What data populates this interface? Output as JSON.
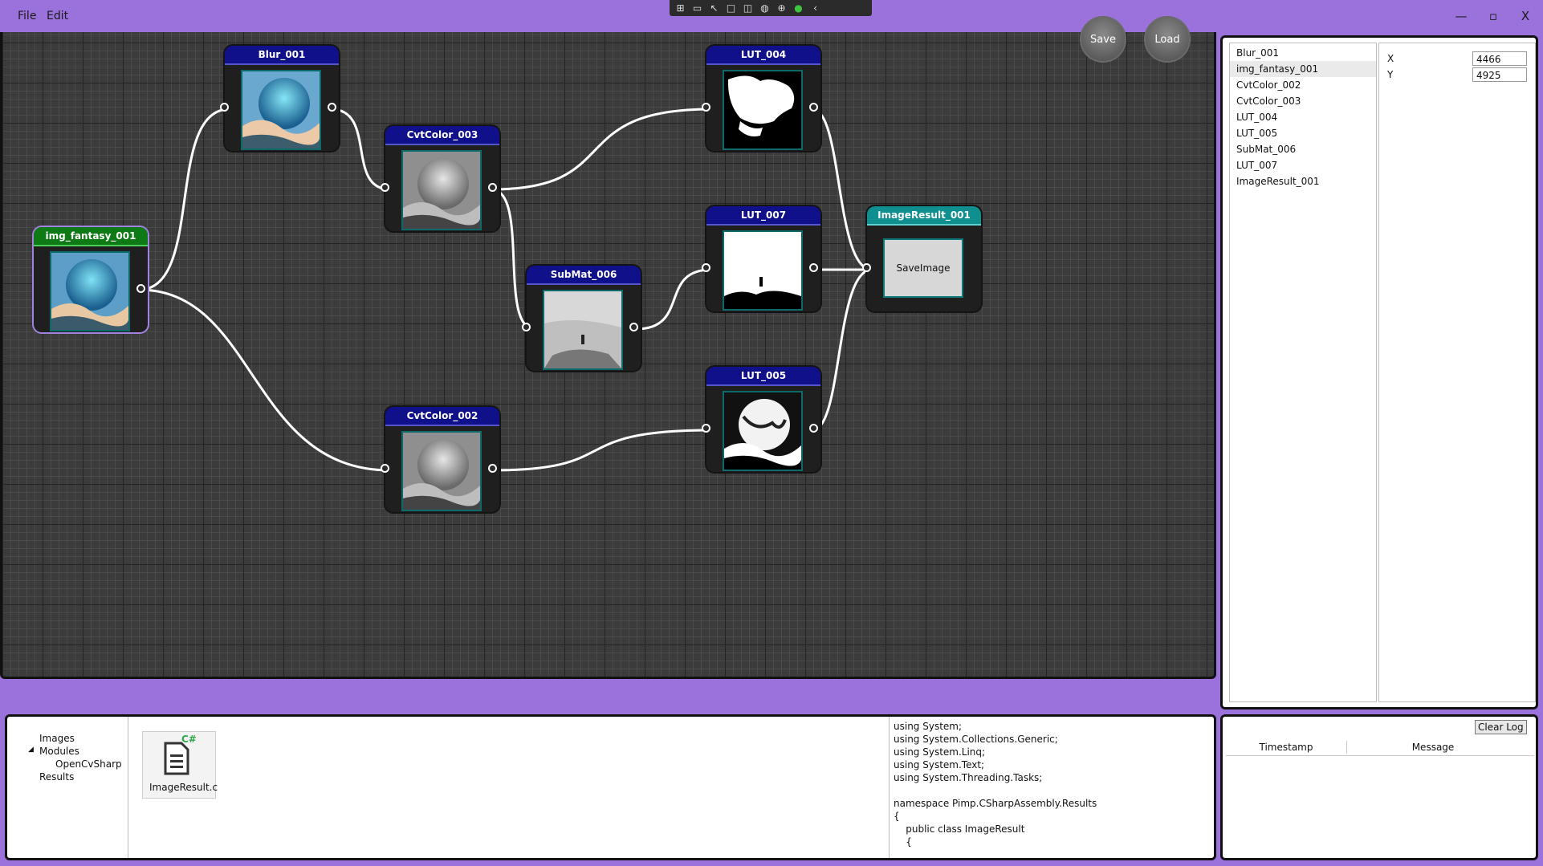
{
  "window": {
    "menu": [
      "File",
      "Edit"
    ],
    "controls": {
      "minimize": "—",
      "maximize": "▫",
      "close": "X"
    }
  },
  "canvas": {
    "buttons": {
      "save": "Save",
      "load": "Load"
    },
    "nodes": [
      {
        "id": "img_fantasy_001",
        "title": "img_fantasy_001",
        "style": "green",
        "thumb": "color"
      },
      {
        "id": "Blur_001",
        "title": "Blur_001",
        "style": "blue",
        "thumb": "color"
      },
      {
        "id": "CvtColor_003",
        "title": "CvtColor_003",
        "style": "blue",
        "thumb": "gray"
      },
      {
        "id": "SubMat_006",
        "title": "SubMat_006",
        "style": "blue",
        "thumb": "gray-crop"
      },
      {
        "id": "CvtColor_002",
        "title": "CvtColor_002",
        "style": "blue",
        "thumb": "gray"
      },
      {
        "id": "LUT_004",
        "title": "LUT_004",
        "style": "blue",
        "thumb": "mask"
      },
      {
        "id": "LUT_007",
        "title": "LUT_007",
        "style": "blue",
        "thumb": "mask-light"
      },
      {
        "id": "LUT_005",
        "title": "LUT_005",
        "style": "blue",
        "thumb": "high-contrast"
      },
      {
        "id": "ImageResult_001",
        "title": "ImageResult_001",
        "style": "teal",
        "content": "SaveImage"
      }
    ]
  },
  "node_list": [
    "Blur_001",
    "img_fantasy_001",
    "CvtColor_002",
    "CvtColor_003",
    "LUT_004",
    "LUT_005",
    "SubMat_006",
    "LUT_007",
    "ImageResult_001"
  ],
  "node_list_selected": "img_fantasy_001",
  "properties": {
    "x_label": "X",
    "x_value": "4466",
    "y_label": "Y",
    "y_value": "4925"
  },
  "tree": {
    "images": "Images",
    "modules": "Modules",
    "opencvsharp": "OpenCvSharp",
    "results": "Results"
  },
  "file": {
    "name": "ImageResult.c",
    "badge": "C#"
  },
  "code": "using System;\nusing System.Collections.Generic;\nusing System.Linq;\nusing System.Text;\nusing System.Threading.Tasks;\n\nnamespace Pimp.CSharpAssembly.Results\n{\n    public class ImageResult\n    {\n        ",
  "log": {
    "clear": "Clear Log",
    "columns": [
      "Timestamp",
      "Message"
    ]
  },
  "colors": {
    "chrome": "#9b72db",
    "node_header": "#10108a",
    "source_header": "#0e7a16",
    "result_header": "#0f8f8f"
  }
}
